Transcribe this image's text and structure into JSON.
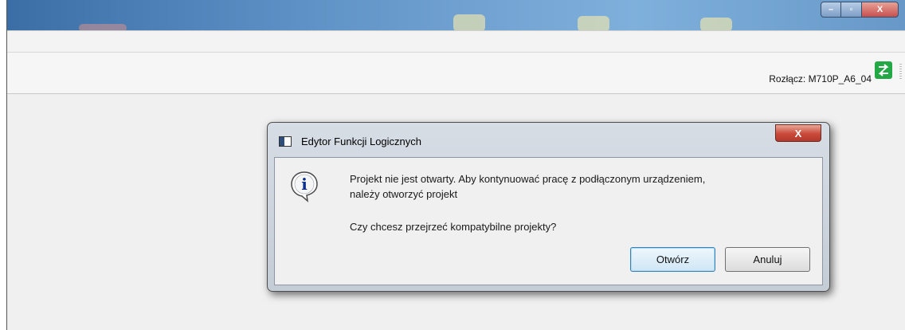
{
  "window": {
    "controls": {
      "minimize": "–",
      "maximize": "▫",
      "close": "X"
    }
  },
  "toolbar": {
    "disconnect_label": "Rozłącz: M710P_A6_04",
    "connect_icon": "connection-status-icon"
  },
  "dialog": {
    "title": "Edytor Funkcji Logicznych",
    "close_label": "X",
    "icon": "info-icon",
    "message_line1": "Projekt nie jest otwarty. Aby kontynuować pracę z podłączonym urządzeniem,",
    "message_line2": "należy otworzyć projekt",
    "question": "Czy chcesz przejrzeć kompatybilne projekty?",
    "open_button": "Otwórz",
    "cancel_button": "Anuluj"
  },
  "colors": {
    "accent_green": "#22a845",
    "close_red": "#c9493a",
    "focus_blue": "#3c7fb1"
  }
}
